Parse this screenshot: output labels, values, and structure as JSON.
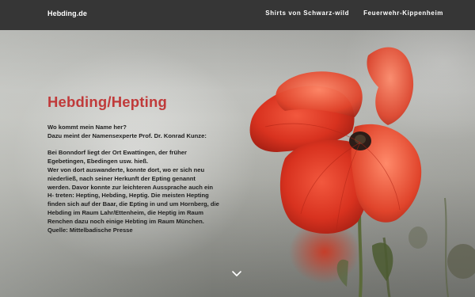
{
  "header": {
    "brand": "Hebding.de",
    "nav": [
      {
        "label": "Shirts von Schwarz-wild"
      },
      {
        "label": "Feuerwehr-Kippenheim"
      }
    ]
  },
  "main": {
    "title": "Hebding/Hepting",
    "intro_lines": [
      "Wo kommt mein Name her?",
      "Dazu meint der Namensexperte Prof. Dr. Konrad Kunze:"
    ],
    "paragraph_lines": [
      "Bei Bonndorf liegt der Ort Ewattingen, der früher",
      "Egebetingen, Ebedingen usw. hieß.",
      "Wer von dort auswanderte, konnte dort, wo er sich neu",
      "niederließ, nach seiner Herkunft der Epting genannt",
      "werden. Davor konnte zur leichteren Aussprache auch ein",
      "H- treten: Hepting, Hebding, Heptig. Die meisten Hepting",
      "finden sich auf der Baar, die Epting in und um Hornberg, die",
      "Hebding im Raum Lahr/Ettenheim, die Heptig im Raum",
      "Renchen dazu noch einige Hebting im Raum München.",
      "Quelle: Mittelbadische Presse"
    ]
  },
  "scroll_icon": "chevron-down-icon",
  "colors": {
    "header_bg": "#363636",
    "title": "#c03a3a",
    "body_text": "#1e1e1e",
    "flower": "#d8321f"
  }
}
